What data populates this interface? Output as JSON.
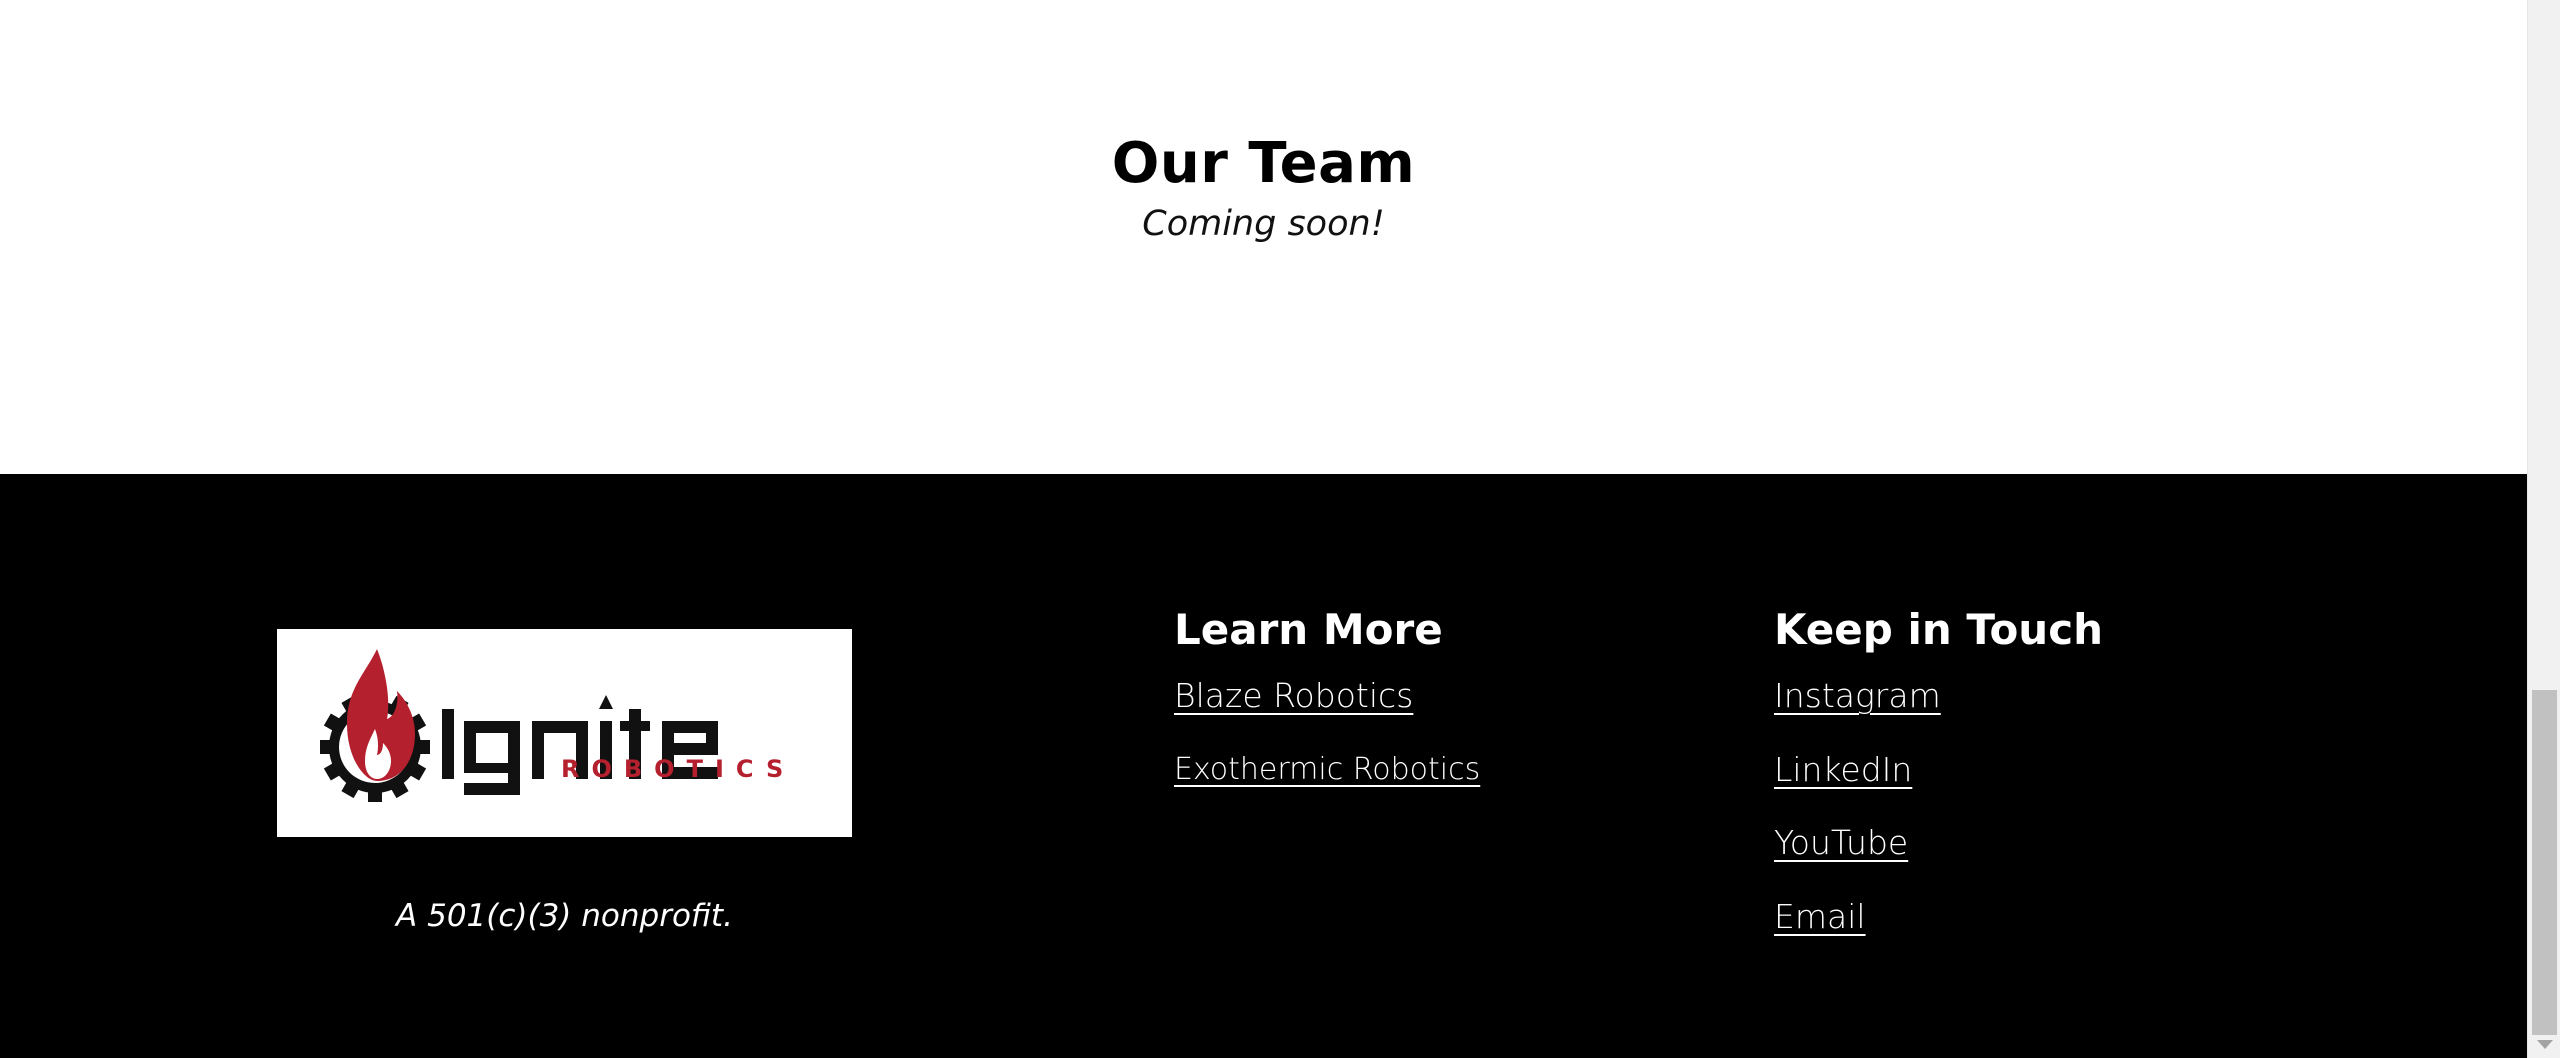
{
  "team": {
    "title": "Our Team",
    "subtitle": "Coming soon!"
  },
  "footer": {
    "logo": {
      "icon": "flame-gear-logo",
      "wordmark": "lgnite",
      "tagline": "ROBOTICS",
      "brand_red": "#b5202e"
    },
    "nonprofit_text": "A 501(c)(3) nonprofit.",
    "learn_more": {
      "heading": "Learn More",
      "links": [
        "Blaze Robotics",
        "Exothermic Robotics"
      ]
    },
    "keep_in_touch": {
      "heading": "Keep in Touch",
      "links": [
        "Instagram",
        "LinkedIn",
        "YouTube",
        "Email"
      ]
    }
  },
  "colors": {
    "footer_bg": "#000000",
    "page_bg": "#ffffff",
    "accent_red": "#b5202e"
  }
}
